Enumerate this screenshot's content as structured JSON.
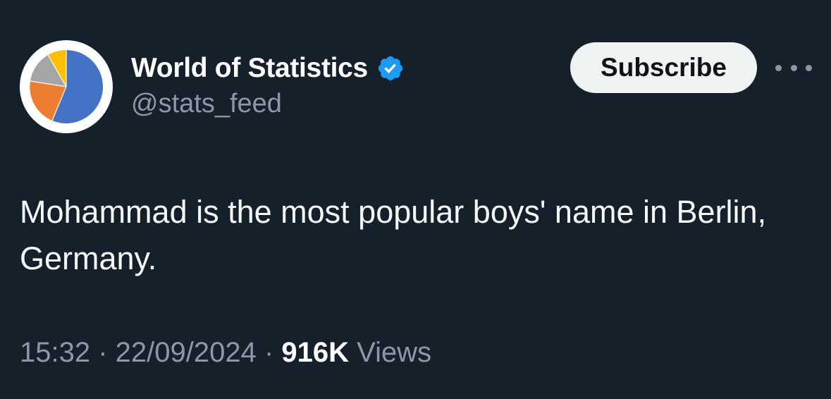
{
  "author": {
    "display_name": "World of Statistics",
    "handle": "@stats_feed",
    "verified": true,
    "avatar_icon": "pie-chart-logo",
    "avatar_colors": [
      "#4472c4",
      "#ed7d31",
      "#a5a5a5",
      "#ffc000"
    ]
  },
  "actions": {
    "subscribe_label": "Subscribe",
    "more_icon": "more-icon"
  },
  "tweet": {
    "text": "Mohammad is the most popular boys' name in Berlin, Germany."
  },
  "meta": {
    "time": "15:32",
    "separator": " · ",
    "date": "22/09/2024",
    "views_count": "916K",
    "views_label": "Views"
  },
  "colors": {
    "background": "#16202b",
    "verified_badge": "#1d9bf0",
    "secondary_text": "#8b98a5"
  }
}
